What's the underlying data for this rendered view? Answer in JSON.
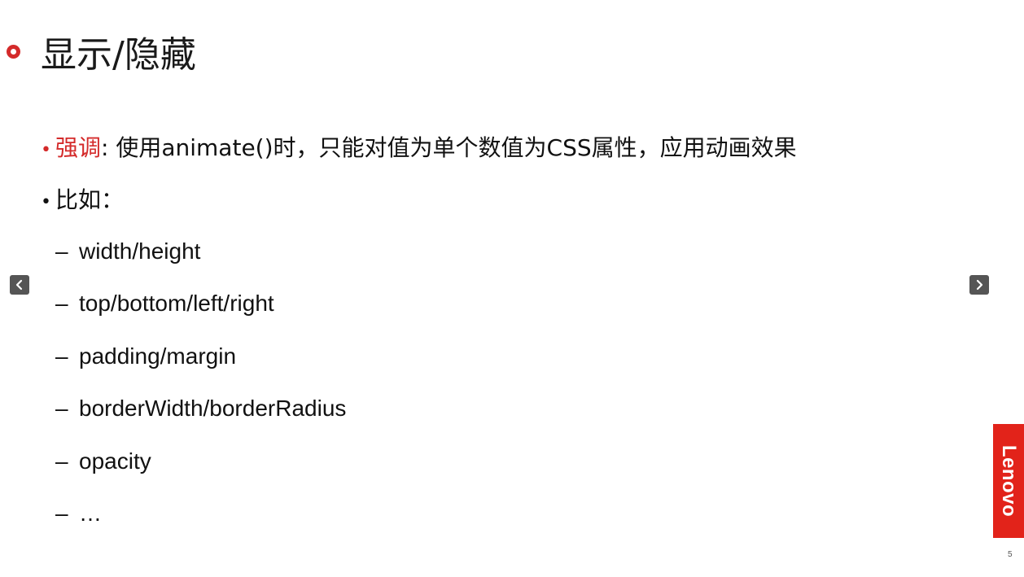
{
  "slide": {
    "title": "显示/隐藏",
    "bullets": [
      {
        "emphasis": "强调",
        "text": ": 使用animate()时，只能对值为单个数值为CSS属性，应用动画效果"
      },
      {
        "emphasis": "",
        "text": "比如："
      }
    ],
    "sub_items": [
      "width/height",
      "top/bottom/left/right",
      "padding/margin",
      "borderWidth/borderRadius",
      "opacity",
      "…"
    ],
    "page_number": "5"
  },
  "navigation": {
    "prev_icon": "chevron-left-icon",
    "next_icon": "chevron-right-icon"
  },
  "brand": {
    "logo_text": "Lenovo",
    "logo_color": "#e2231a",
    "accent_color": "#d42a2a"
  }
}
